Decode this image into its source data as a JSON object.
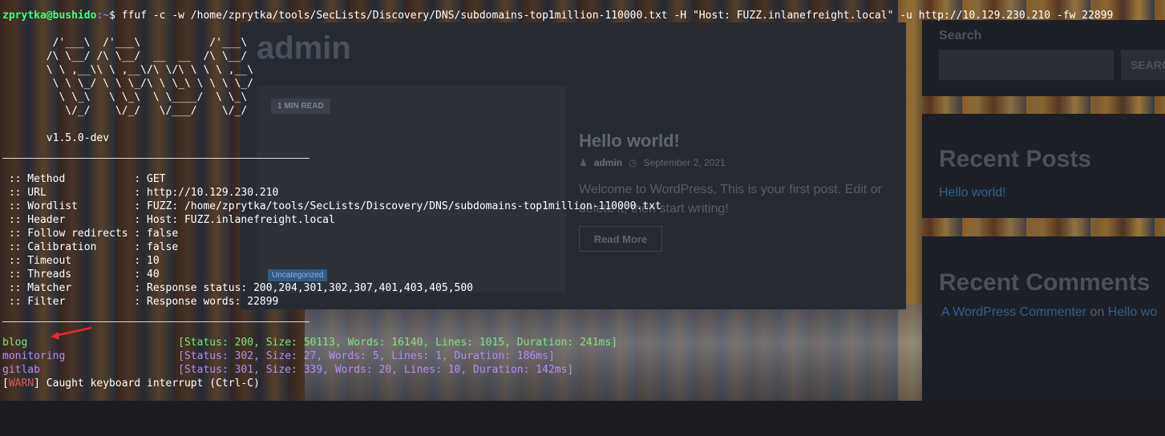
{
  "terminal": {
    "prompt_user_host": "zprytka@bushido",
    "prompt_path": ":~",
    "prompt_symbol": "$",
    "command": " ffuf -c -w /home/zprytka/tools/SecLists/Discovery/DNS/subdomains-top1million-110000.txt -H \"Host: FUZZ.inlanefreight.local\" -u http://10.129.230.210 -fw 22899",
    "banner": [
      "        /'___\\  /'___\\           /'___\\",
      "       /\\ \\__/ /\\ \\__/  __  __  /\\ \\__/",
      "       \\ \\ ,__\\\\ \\ ,__\\/\\ \\/\\ \\ \\ \\ ,__\\",
      "        \\ \\ \\_/ \\ \\ \\_/\\ \\ \\_\\ \\ \\ \\ \\_/",
      "         \\ \\_\\   \\ \\_\\  \\ \\____/  \\ \\_\\",
      "          \\/_/    \\/_/   \\/___/    \\/_/"
    ],
    "version": "       v1.5.0-dev",
    "config": [
      " :: Method           : GET",
      " :: URL              : http://10.129.230.210",
      " :: Wordlist         : FUZZ: /home/zprytka/tools/SecLists/Discovery/DNS/subdomains-top1million-110000.txt",
      " :: Header           : Host: FUZZ.inlanefreight.local",
      " :: Follow redirects : false",
      " :: Calibration      : false",
      " :: Timeout          : 10",
      " :: Threads          : 40",
      " :: Matcher          : Response status: 200,204,301,302,307,401,403,405,500",
      " :: Filter           : Response words: 22899"
    ],
    "results": [
      {
        "name": "blog",
        "padding": "                        ",
        "detail": "[Status: 200, Size: 50113, Words: 16140, Lines: 1015, Duration: 241ms]"
      },
      {
        "name": "monitoring",
        "padding": "                  ",
        "detail": "[Status: 302, Size: 27, Words: 5, Lines: 1, Duration: 186ms]"
      },
      {
        "name": "gitlab",
        "padding": "                      ",
        "detail": "[Status: 301, Size: 339, Words: 20, Lines: 10, Duration: 142ms]"
      }
    ],
    "warn_open": "[",
    "warn_tag": "WARN",
    "warn_close": "] Caught keyboard interrupt (Ctrl-C)",
    "colors": {
      "green": "#7ee57e",
      "purple": "#b98cf5",
      "warn": "#e05555",
      "arrow": "#e02a2a"
    }
  },
  "webpage": {
    "page_title": "admin",
    "read_badge": "1 MIN READ",
    "category_badge": "Uncategorized",
    "post_title": "Hello world!",
    "post_author": "admin",
    "post_date": "September 2, 2021",
    "post_excerpt": "Welcome to WordPress. This is your first post. Edit or delete it, then start writing!",
    "read_more": "Read More",
    "search_label": "Search",
    "search_button": "SEARC",
    "recent_posts_title": "Recent Posts",
    "recent_post_link": "Hello world!",
    "recent_comments_title": "Recent Comments",
    "comment_author": "A WordPress Commenter",
    "comment_on": " on ",
    "comment_post": "Hello wo"
  }
}
